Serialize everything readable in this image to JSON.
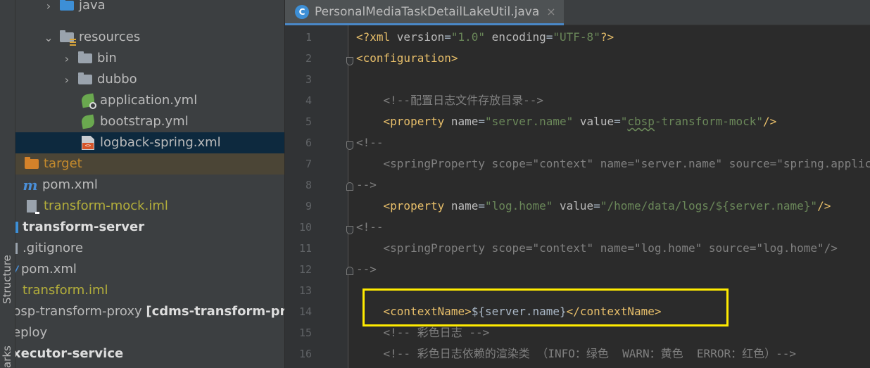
{
  "toolstrip": {
    "structure_label": "Structure",
    "bookmarks_label": "arks"
  },
  "tree": {
    "java": "java",
    "resources": "resources",
    "bin": "bin",
    "dubbo": "dubbo",
    "application_yml": "application.yml",
    "bootstrap_yml": "bootstrap.yml",
    "logback_xml": "logback-spring.xml",
    "target": "target",
    "pom_xml": "pom.xml",
    "transform_mock_iml": "transform-mock.iml",
    "transform_server": "transform-server",
    "gitignore": ".gitignore",
    "root_pom_xml": "pom.xml",
    "transform_iml": "transform.iml",
    "proxy_module": "bsp-transform-proxy",
    "proxy_module_suffix": "[cdms-transform-prox",
    "deploy": "eploy",
    "executor_service": "xecutor-service"
  },
  "editor": {
    "tab_title": "PersonalMediaTaskDetailLakeUtil.java",
    "tab_close": "×",
    "line_numbers": [
      "1",
      "2",
      "3",
      "4",
      "5",
      "6",
      "7",
      "8",
      "9",
      "10",
      "11",
      "12",
      "13",
      "14",
      "15",
      "16"
    ],
    "l1": {
      "a": "<?xml ",
      "b": "version",
      "c": "=",
      "d": "\"1.0\"",
      "e": " encoding",
      "f": "=",
      "g": "\"UTF-8\"",
      "h": "?>"
    },
    "l2": {
      "a": "<configuration>"
    },
    "l4": {
      "a": "    <!--配置日志文件存放目录-->"
    },
    "l5": {
      "a": "    <property",
      "b": " name",
      "c": "=",
      "d": "\"server.name\"",
      "e": " value",
      "f": "=",
      "g": "\"",
      "h": "cbsp",
      "i": "-transform-mock\"",
      "j": "/>"
    },
    "l6": {
      "a": "<!--"
    },
    "l7": {
      "a": "    <springProperty scope=\"context\" name=\"server.name\" source=\"spring.application.name\"/>"
    },
    "l8": {
      "a": "-->"
    },
    "l9": {
      "a": "    <property",
      "b": " name",
      "c": "=",
      "d": "\"log.home\"",
      "e": " value",
      "f": "=",
      "g": "\"/home/data/logs/${server.name}\"",
      "h": "/>"
    },
    "l10": {
      "a": "<!--"
    },
    "l11": {
      "a": "    <springProperty scope=\"context\" name=\"log.home\" source=\"log.home\"/>"
    },
    "l12": {
      "a": "-->"
    },
    "l14": {
      "a": "    <contextName>",
      "b": "${server.name}",
      "c": "</contextName>"
    },
    "l15": {
      "a": "    <!-- 彩色日志 -->"
    },
    "l16": {
      "a": "    <!-- 彩色日志依赖的渲染类 （INFO：绿色  WARN：黄色  ERROR：红色）-->"
    }
  },
  "colors": {
    "highlight_box": "#ffeb00",
    "tag": "#e8bf6a",
    "value": "#6a8759",
    "comment": "#808080",
    "selected_row": "#0d293e"
  }
}
